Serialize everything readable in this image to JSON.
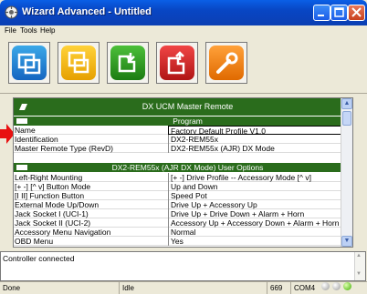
{
  "window": {
    "title": "Wizard Advanced - Untitled"
  },
  "menu": {
    "file": "File",
    "tools": "Tools",
    "help": "Help"
  },
  "toolbar": {
    "icons": [
      "new-document-icon",
      "save-icon",
      "read-from-controller-icon",
      "write-to-controller-icon",
      "tools-wrench-icon"
    ]
  },
  "panel": {
    "main_header": "DX UCM Master Remote",
    "section1": "Program",
    "section2": "DX2-REM55x (AJR DX Mode) User Options",
    "rows1": [
      {
        "k": "Name",
        "v": "Factory Default Profile V1.0"
      },
      {
        "k": "Identification",
        "v": "DX2-REM55x"
      },
      {
        "k": "Master Remote Type (RevD)",
        "v": "DX2-REM55x (AJR) DX Mode"
      }
    ],
    "rows2": [
      {
        "k": "Left-Right Mounting",
        "v": "[+ -] Drive Profile -- Accessory Mode [^ v]"
      },
      {
        "k": "[+ -] [^ v] Button Mode",
        "v": "Up and Down"
      },
      {
        "k": "[I II] Function Button",
        "v": "Speed Pot"
      },
      {
        "k": "External Mode Up/Down",
        "v": "Drive Up + Accessory Up"
      },
      {
        "k": "Jack Socket I (UCI-1)",
        "v": "Drive Up + Drive Down + Alarm + Horn"
      },
      {
        "k": "Jack Socket II (UCI-2)",
        "v": "Accessory Up + Accessory Down + Alarm + Horn"
      },
      {
        "k": "Accessory Menu Navigation",
        "v": "Normal"
      },
      {
        "k": "OBD Menu",
        "v": "Yes"
      }
    ]
  },
  "status": {
    "message": "Controller connected"
  },
  "statusbar": {
    "left": "Done",
    "mid": "Idle",
    "num": "669",
    "port": "COM4"
  },
  "colors": {
    "header_green": "#2a6c1c",
    "arrow_red": "#e81010"
  }
}
